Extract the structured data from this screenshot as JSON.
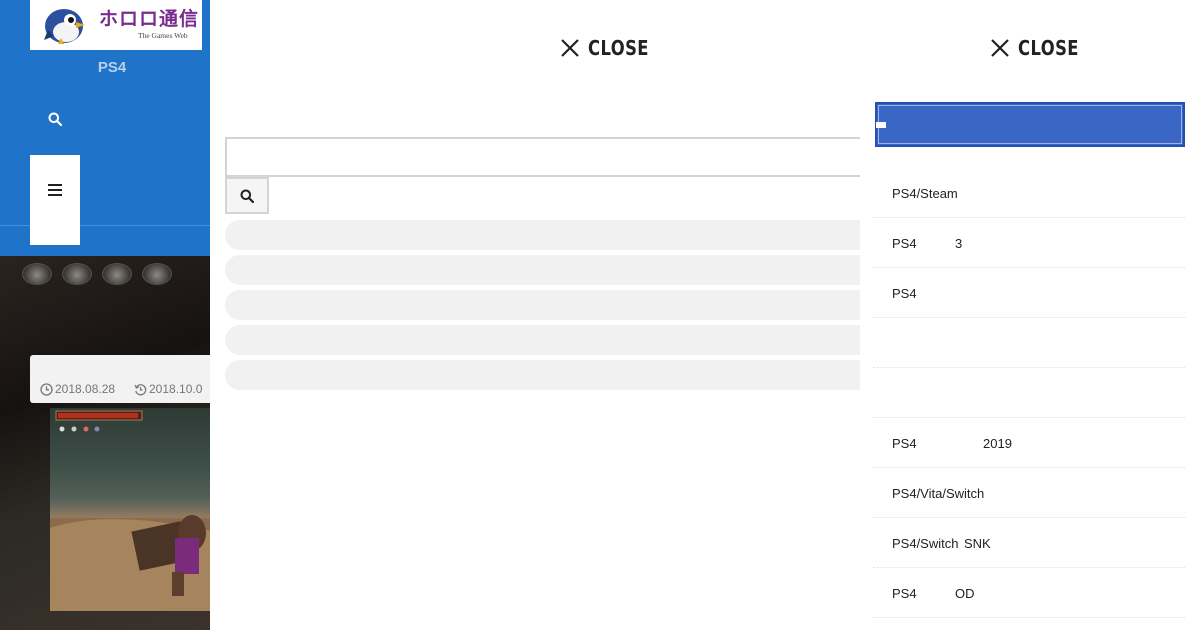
{
  "site": {
    "logo_text": "ホロロ通信",
    "logo_sub": "The Games Web",
    "platform": "PS4"
  },
  "post": {
    "published": "2018.08.28",
    "updated": "2018.10.0"
  },
  "search_overlay": {
    "close_label": "CLOSE",
    "input_value": "",
    "input_placeholder": ""
  },
  "menu_overlay": {
    "close_label": "CLOSE",
    "items": [
      {
        "a": "PS4/Steam",
        "b": ""
      },
      {
        "a": "PS4",
        "b": "3"
      },
      {
        "a": "PS4",
        "b": ""
      },
      {
        "a": "",
        "b": ""
      },
      {
        "a": "",
        "b": ""
      },
      {
        "a": "PS4",
        "b": "2019"
      },
      {
        "a": "PS4/Vita/Switch",
        "b": ""
      },
      {
        "a": "PS4/Switch",
        "b": "SNK"
      },
      {
        "a": "PS4",
        "b": "OD"
      }
    ]
  },
  "colors": {
    "header_blue": "#1f73c9",
    "menu_search_blue": "#3a66c6",
    "logo_purple": "#7a2c8f"
  },
  "icons": [
    "search-icon",
    "hamburger-menu-icon",
    "close-icon",
    "clock-icon",
    "update-icon"
  ]
}
